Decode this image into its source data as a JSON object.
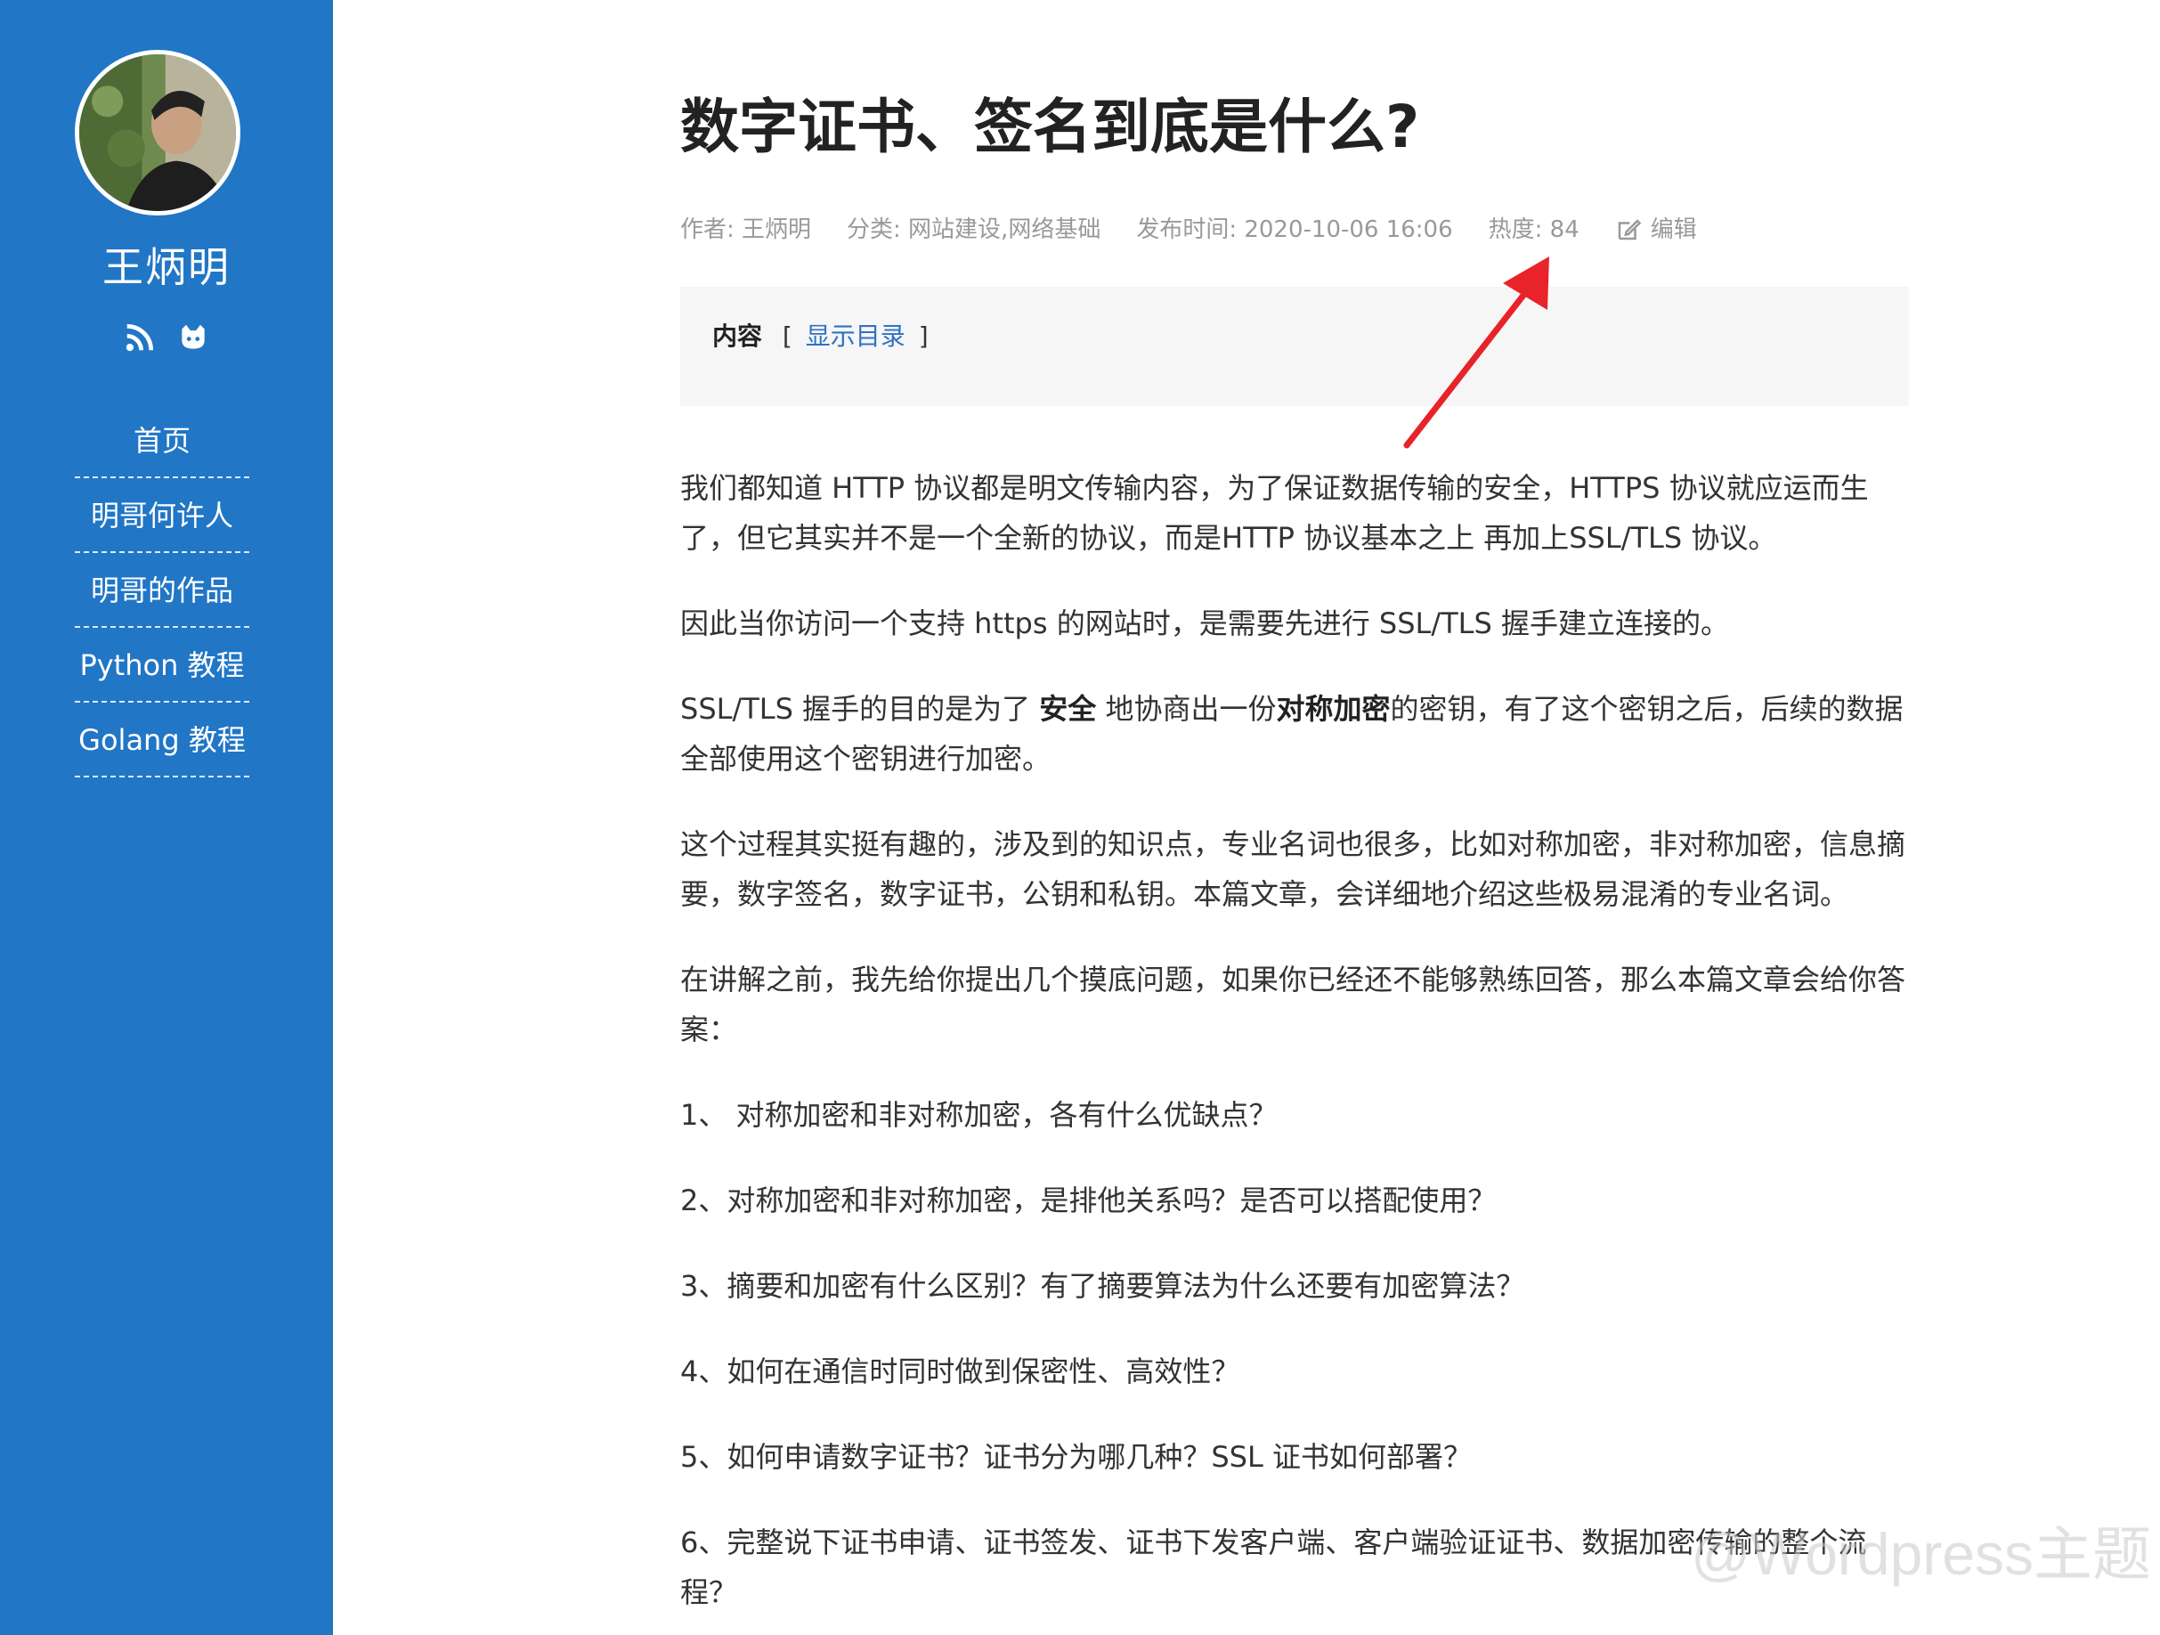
{
  "sidebar": {
    "site_name": "王炳明",
    "social": [
      "rss-icon",
      "github-icon"
    ],
    "nav": [
      "首页",
      "明哥何许人",
      "明哥的作品",
      "Python 教程",
      "Golang 教程"
    ],
    "background": "#2176c6"
  },
  "article": {
    "title": "数字证书、签名到底是什么?",
    "meta": {
      "author": "作者: 王炳明",
      "category": "分类: 网站建设,网络基础",
      "published": "发布时间: 2020-10-06 16:06",
      "heat": "热度:  84",
      "edit": "编辑"
    },
    "toc": {
      "title": "内容",
      "bracket_open": "[",
      "link": "显示目录",
      "bracket_close": "]"
    },
    "paragraphs": [
      "我们都知道 HTTP 协议都是明文传输内容，为了保证数据传输的安全，HTTPS 协议就应运而生了，但它其实并不是一个全新的协议，而是HTTP 协议基本之上 再加上SSL/TLS 协议。",
      "因此当你访问一个支持 https 的网站时，是需要先进行 SSL/TLS 握手建立连接的。",
      "这个过程其实挺有趣的，涉及到的知识点，专业名词也很多，比如对称加密，非对称加密，信息摘要，数字签名，数字证书，公钥和私钥。本篇文章，会详细地介绍这些极易混淆的专业名词。",
      "在讲解之前，我先给你提出几个摸底问题，如果你已经还不能够熟练回答，那么本篇文章会给你答案：",
      "1、 对称加密和非对称加密，各有什么优缺点？",
      "2、对称加密和非对称加密，是排他关系吗？是否可以搭配使用？",
      "3、摘要和加密有什么区别？有了摘要算法为什么还要有加密算法？",
      "4、如何在通信时同时做到保密性、高效性？",
      "5、如何申请数字证书？证书分为哪几种？SSL 证书如何部署？",
      "6、完整说下证书申请、证书签发、证书下发客户端、客户端验证证书、数据加密传输的整个流程？"
    ],
    "ssl_paragraph": {
      "part1": "SSL/TLS 握手的目的是为了 ",
      "bold1": "安全",
      "part2": " 地协商出一份",
      "bold2": "对称加密",
      "part3": "的密钥，有了这个密钥之后，后续的数据全部使用这个密钥进行加密。"
    }
  },
  "watermark": "@Wordpress主题",
  "colors": {
    "link": "#2f72c4",
    "arrow": "#e8232a",
    "meta": "#999999"
  }
}
